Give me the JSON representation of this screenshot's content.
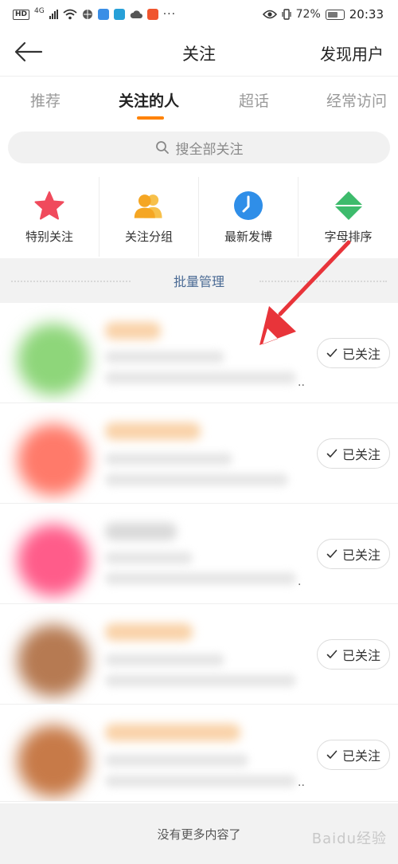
{
  "status_bar": {
    "hd": "HD",
    "network": "4G",
    "dots": "···",
    "battery": "72%",
    "time": "20:33"
  },
  "nav": {
    "title": "关注",
    "right_action": "发现用户"
  },
  "tabs": [
    {
      "label": "推荐",
      "active": false
    },
    {
      "label": "关注的人",
      "active": true
    },
    {
      "label": "超话",
      "active": false
    },
    {
      "label": "经常访问",
      "active": false
    }
  ],
  "search": {
    "placeholder": "搜全部关注"
  },
  "quick_entries": [
    {
      "label": "特别关注",
      "icon": "star-icon",
      "color": "#f04a5c"
    },
    {
      "label": "关注分组",
      "icon": "group-icon",
      "color": "#f5a623"
    },
    {
      "label": "最新发博",
      "icon": "clock-icon",
      "color": "#2f8ee8"
    },
    {
      "label": "字母排序",
      "icon": "sort-icon",
      "color": "#3dbb6c"
    }
  ],
  "batch_manage": "批量管理",
  "follow_list": [
    {
      "follow_label": "已关注",
      "avatar_color": "#8ed67a"
    },
    {
      "follow_label": "已关注",
      "avatar_color": "#ff7a6a"
    },
    {
      "follow_label": "已关注",
      "avatar_color": "#ff5c8a"
    },
    {
      "follow_label": "已关注",
      "avatar_color": "#b67a52"
    },
    {
      "follow_label": "已关注",
      "avatar_color": "#c77a48"
    }
  ],
  "footer": {
    "text": "没有更多内容了"
  },
  "watermark": "Baidu经验",
  "colors": {
    "accent": "#ff8200",
    "link": "#4a6a94",
    "annotation": "#e8343a"
  }
}
